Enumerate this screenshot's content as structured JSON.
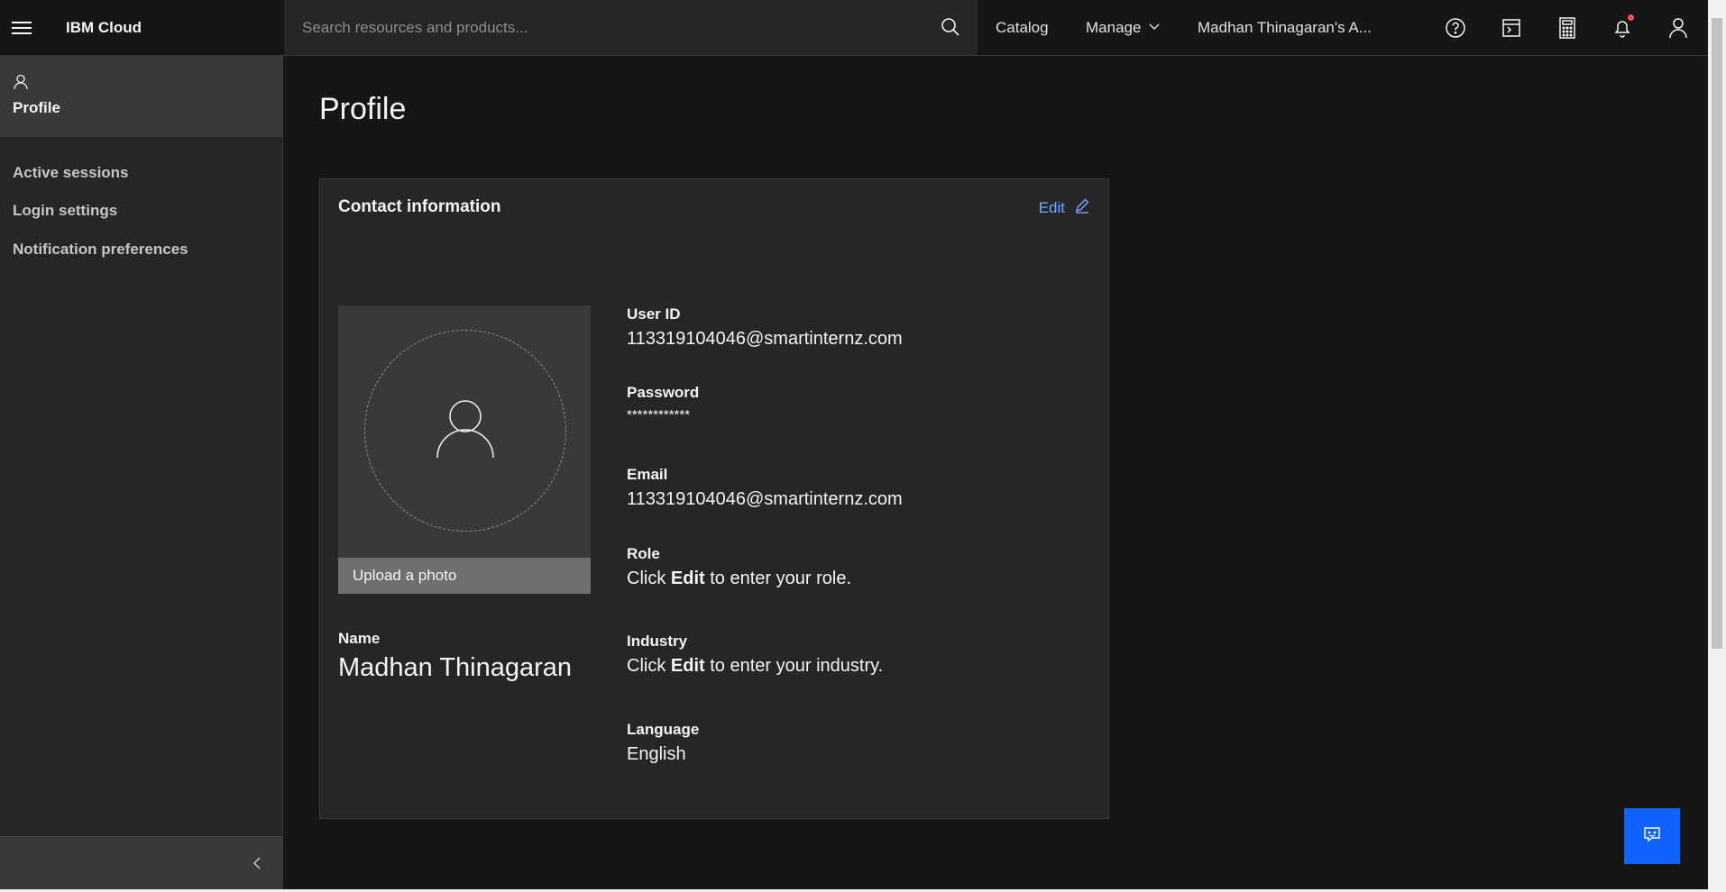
{
  "header": {
    "brand": "IBM Cloud",
    "search_placeholder": "Search resources and products...",
    "catalog": "Catalog",
    "manage": "Manage",
    "account": "Madhan Thinagaran's A..."
  },
  "sidebar": {
    "active": "Profile",
    "items": [
      {
        "label": "Active sessions"
      },
      {
        "label": "Login settings"
      },
      {
        "label": "Notification preferences"
      }
    ]
  },
  "main": {
    "title": "Profile",
    "card": {
      "title": "Contact information",
      "edit_label": "Edit",
      "upload_label": "Upload a photo",
      "name_label": "Name",
      "name_value": "Madhan Thinagaran",
      "fields": {
        "user_id": {
          "label": "User ID",
          "value": "113319104046@smartinternz.com"
        },
        "password": {
          "label": "Password",
          "value": "************"
        },
        "email": {
          "label": "Email",
          "value": "113319104046@smartinternz.com"
        },
        "role": {
          "label": "Role",
          "prefix": "Click",
          "bold": "Edit",
          "suffix": "to enter your role."
        },
        "industry": {
          "label": "Industry",
          "prefix": "Click",
          "bold": "Edit",
          "suffix": "to enter your industry."
        },
        "language": {
          "label": "Language",
          "value": "English"
        }
      }
    }
  },
  "colors": {
    "accent": "#0f62fe",
    "link": "#78a9ff",
    "notification": "#fa4d56"
  }
}
